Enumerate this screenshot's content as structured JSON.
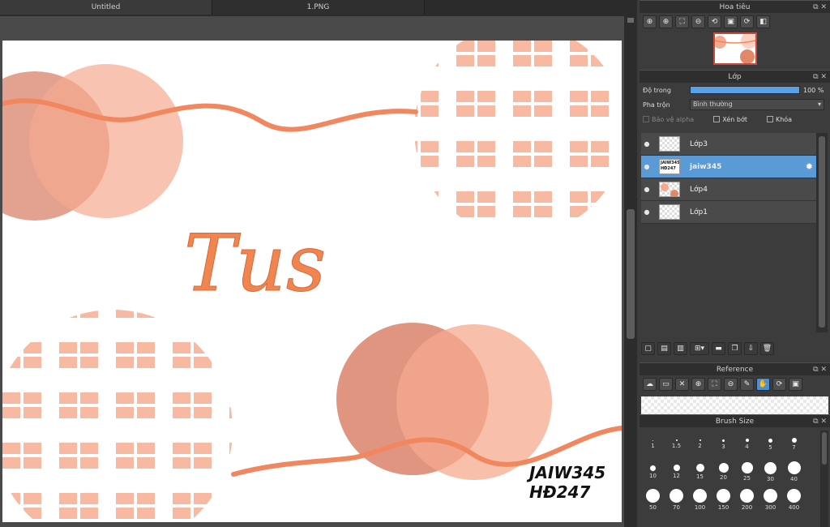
{
  "tabs": [
    {
      "label": "Untitled"
    },
    {
      "label": "1.PNG"
    }
  ],
  "canvas": {
    "title_text": "Tus",
    "watermark_line1": "JAIW345",
    "watermark_line2": "HĐ247",
    "colors": {
      "peach": "#f7b39a",
      "dark_peach": "#e08868",
      "stroke": "#f08a60"
    }
  },
  "navigator": {
    "title": "Hoa tiêu",
    "tools": [
      "zoom-in-icon",
      "zoom-in-icon",
      "fit-icon",
      "zoom-out-icon",
      "rotate-left-icon",
      "fit-screen-icon",
      "rotate-right-icon",
      "flip-icon"
    ]
  },
  "layer_panel": {
    "title": "Lớp",
    "opacity_label": "Độ trong",
    "opacity_value": "100 %",
    "opacity_fraction": 1.0,
    "blend_label": "Pha trộn",
    "blend_value": "Bình thường",
    "protect_alpha_label": "Bảo vệ alpha",
    "clipping_label": "Xén bớt",
    "lock_label": "Khóa",
    "layers": [
      {
        "name": "Lớp3",
        "selected": false
      },
      {
        "name": "jaiw345",
        "selected": true
      },
      {
        "name": "Lớp4",
        "selected": false
      },
      {
        "name": "Lớp1",
        "selected": false
      }
    ],
    "selected_thumb_line1": "JAIW345",
    "selected_thumb_line2": "HĐ247"
  },
  "reference": {
    "title": "Reference"
  },
  "brush_size": {
    "title": "Brush Size",
    "sizes": [
      "1",
      "1.5",
      "2",
      "3",
      "4",
      "5",
      "7",
      "10",
      "12",
      "15",
      "20",
      "25",
      "30",
      "40",
      "50",
      "70",
      "100",
      "150",
      "200",
      "300",
      "400"
    ]
  }
}
